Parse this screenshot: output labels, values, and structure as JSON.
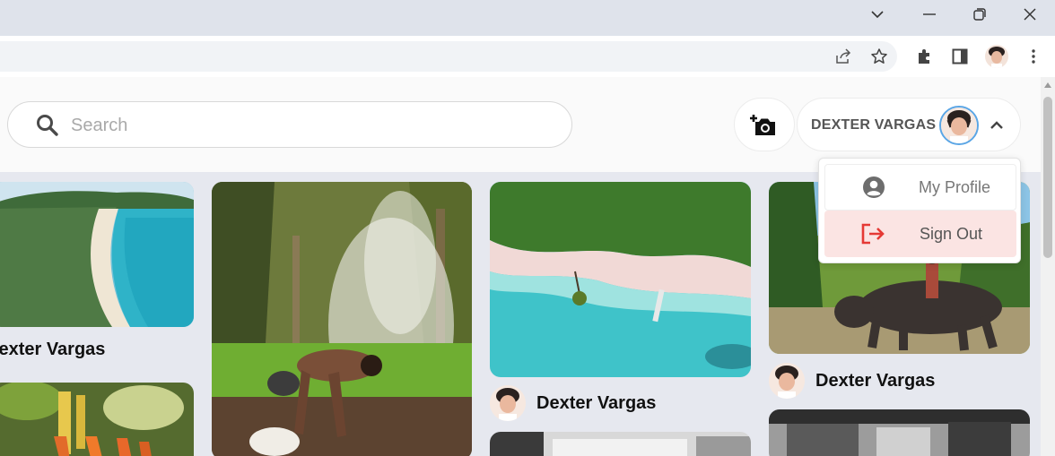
{
  "browser": {
    "window_controls": [
      "chevron-down",
      "minimize",
      "restore",
      "close"
    ],
    "toolbar_icons": [
      "share-icon",
      "star-icon",
      "extensions-icon",
      "side-panel-icon",
      "profile-avatar",
      "menu-icon"
    ]
  },
  "header": {
    "search": {
      "placeholder": "Search",
      "value": ""
    },
    "user": {
      "name": "DEXTER VARGAS"
    }
  },
  "menu": {
    "items": [
      {
        "label": "My Profile",
        "icon": "user-circle-icon"
      },
      {
        "label": "Sign Out",
        "icon": "sign-out-icon",
        "color": "#e53935"
      }
    ]
  },
  "feed": {
    "cards": [
      {
        "author": "Dexter Vargas",
        "image": "beach coastline"
      },
      {
        "author": "",
        "image": "forest smoke"
      },
      {
        "author": "Dexter Vargas",
        "image": "aerial beach"
      },
      {
        "author": "Dexter Vargas",
        "image": "water buffalo"
      },
      {
        "author": "",
        "image": "vegetables"
      },
      {
        "author": "",
        "image": "black and white"
      },
      {
        "author": "",
        "image": "black and white market"
      }
    ]
  },
  "colors": {
    "accent": "#5aa6e6",
    "danger": "#e53935",
    "danger_bg": "#fbe4e3"
  }
}
